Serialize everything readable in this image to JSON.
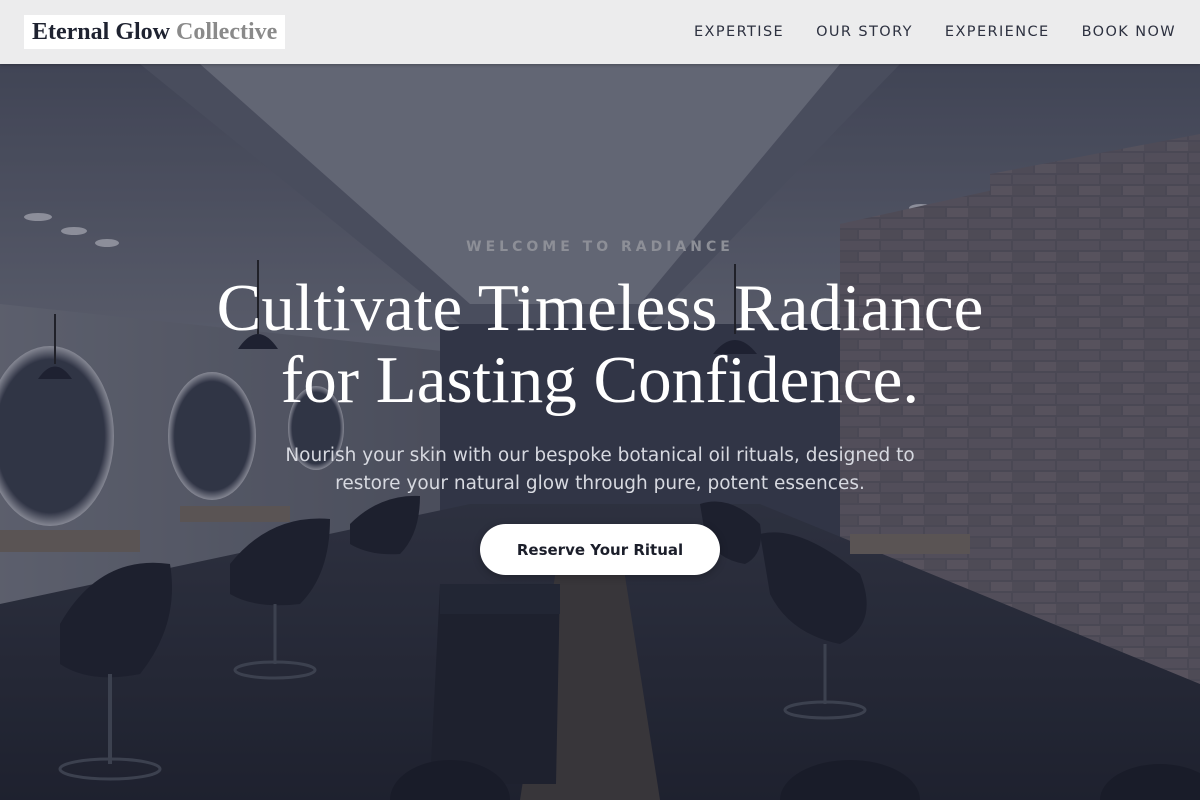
{
  "header": {
    "logo": {
      "primary": "Eternal Glow",
      "secondary": "Collective"
    },
    "nav": [
      {
        "label": "EXPERTISE"
      },
      {
        "label": "OUR STORY"
      },
      {
        "label": "EXPERIENCE"
      },
      {
        "label": "BOOK NOW"
      }
    ]
  },
  "hero": {
    "eyebrow": "WELCOME TO RADIANCE",
    "headline_line1": "Cultivate Timeless Radiance",
    "headline_line2": "for Lasting Confidence.",
    "subtext": "Nourish your skin with our bespoke botanical oil rituals, designed to restore your natural glow through pure, potent essences.",
    "cta_label": "Reserve Your Ritual"
  }
}
